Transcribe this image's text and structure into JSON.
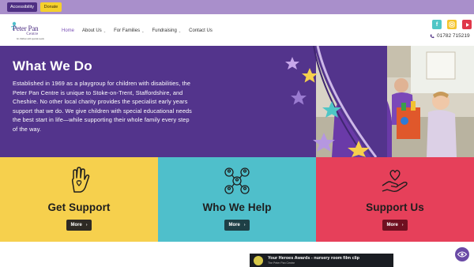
{
  "topbar": {
    "accessibility_label": "Accessibility",
    "donate_label": "Donate"
  },
  "header": {
    "logo": {
      "name_top": "Peter Pan",
      "name_bottom": "Centre",
      "tagline": "for children with special needs"
    },
    "nav": [
      {
        "label": "Home",
        "active": true,
        "dropdown": false
      },
      {
        "label": "About Us",
        "active": false,
        "dropdown": true
      },
      {
        "label": "For Families",
        "active": false,
        "dropdown": true
      },
      {
        "label": "Fundraising",
        "active": false,
        "dropdown": true
      },
      {
        "label": "Contact Us",
        "active": false,
        "dropdown": false
      }
    ],
    "social": {
      "facebook": "f",
      "instagram": "◎",
      "youtube": "▶"
    },
    "phone": "01782 715219"
  },
  "hero": {
    "title": "What We Do",
    "text": "Established in 1969 as a playgroup for children with disabilities, the Peter Pan Centre is unique to Stoke-on-Trent, Staffordshire, and Cheshire. No other local charity provides the specialist early years support that we do. We give children with special educational needs the best start in life—while supporting their whole family every step of the way."
  },
  "tiles": [
    {
      "title": "Get Support",
      "button": "More",
      "icon": "hand-heart-icon",
      "color": "#f6d04d"
    },
    {
      "title": "Who We Help",
      "button": "More",
      "icon": "people-network-icon",
      "color": "#4fbfcb"
    },
    {
      "title": "Support Us",
      "button": "More",
      "icon": "hand-holding-heart-icon",
      "color": "#e6405a"
    }
  ],
  "video": {
    "title": "Your Heroes Awards - nursery room film clip",
    "channel": "The Peter Pan Centre"
  },
  "colors": {
    "brand_purple": "#53348c",
    "accent_yellow": "#f5d02c",
    "teal": "#4fbfcb",
    "red": "#e6405a"
  }
}
